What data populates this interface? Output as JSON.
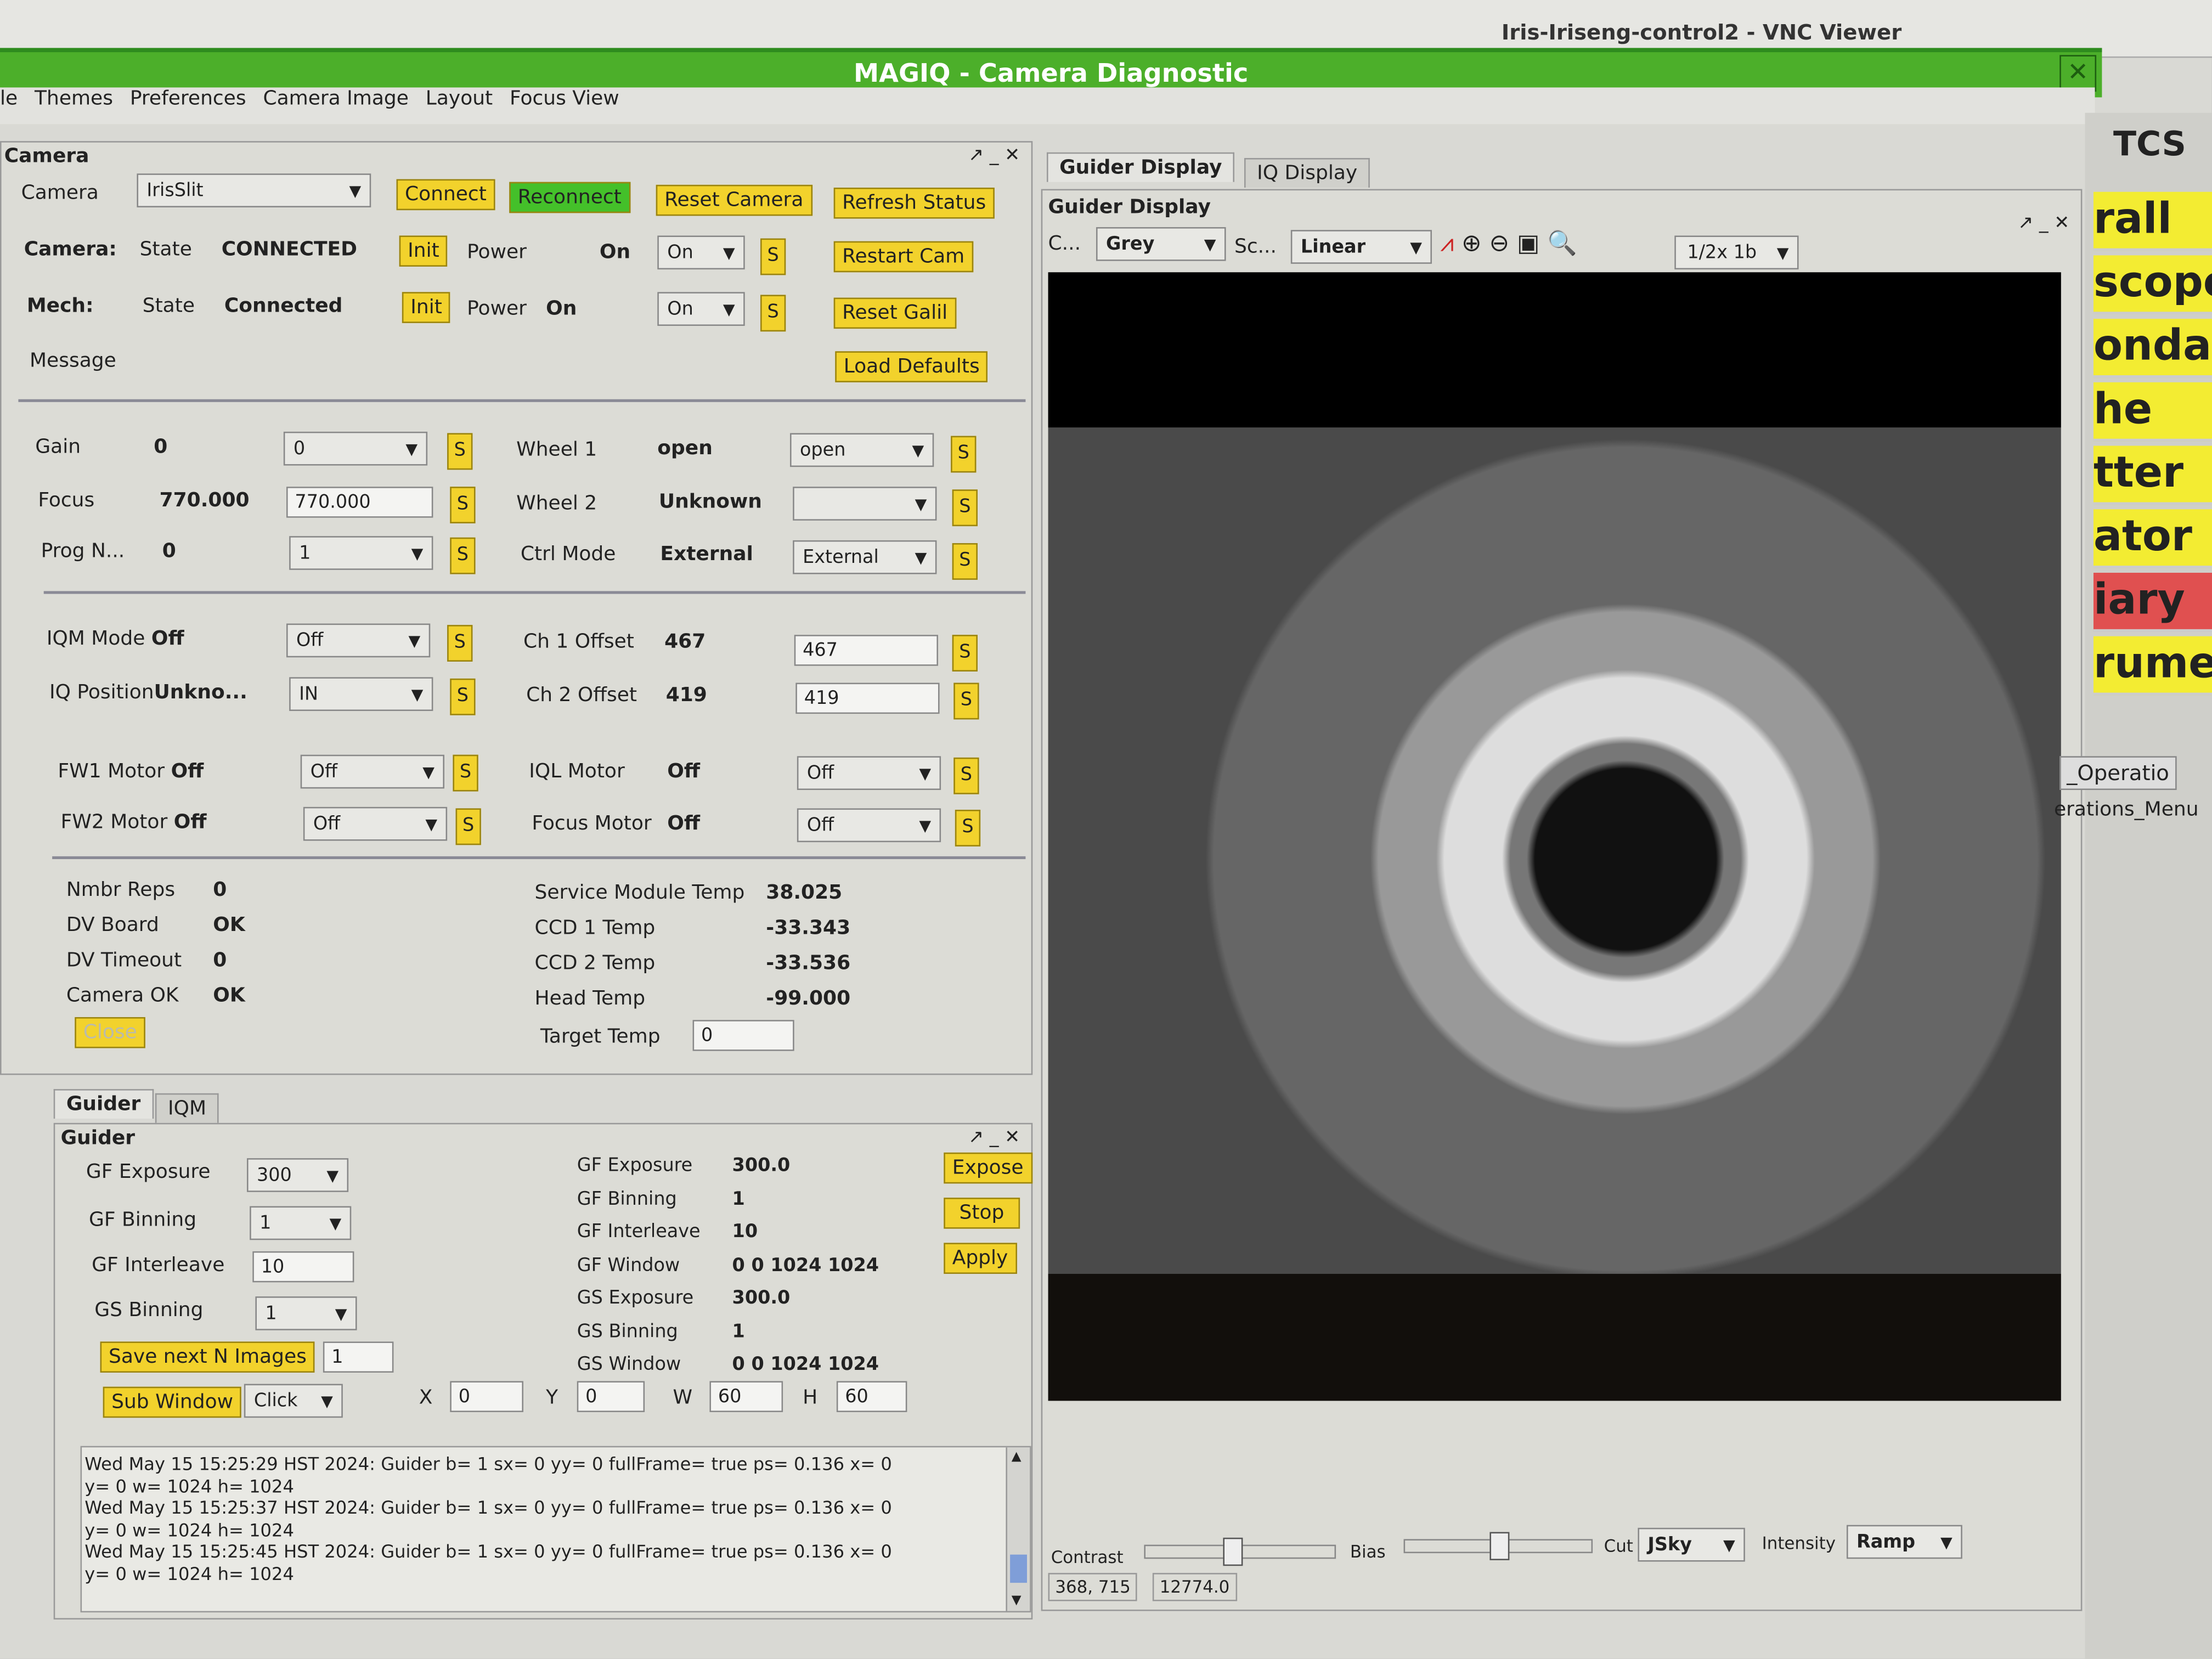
{
  "vnc_title": "Iris-Iriseng-control2 - VNC Viewer",
  "app_title": "MAGIQ - Camera Diagnostic",
  "menu": [
    "le",
    "Themes",
    "Preferences",
    "Camera Image",
    "Layout",
    "Focus View"
  ],
  "camera": {
    "panel_title": "Camera",
    "camera_label": "Camera",
    "camera_value": "IrisSlit",
    "connect": "Connect",
    "reconnect": "Reconnect",
    "reset_camera": "Reset Camera",
    "refresh_status": "Refresh Status",
    "cam_label": "Camera:",
    "state_label": "State",
    "cam_state": "CONNECTED",
    "init": "Init",
    "power_label": "Power",
    "cam_power": "On",
    "cam_power_sel": "On",
    "s": "S",
    "restart_cam": "Restart Cam",
    "mech_label": "Mech:",
    "mech_state": "Connected",
    "mech_power_label": "Power",
    "mech_power": "On",
    "mech_power_sel": "On",
    "reset_galil": "Reset Galil",
    "message_label": "Message",
    "load_defaults": "Load Defaults",
    "gain_label": "Gain",
    "gain": "0",
    "gain_sel": "0",
    "focus_label": "Focus",
    "focus": "770.000",
    "focus_input": "770.000",
    "prog_label": "Prog N...",
    "prog": "0",
    "prog_sel": "1",
    "wheel1_label": "Wheel 1",
    "wheel1": "open",
    "wheel1_sel": "open",
    "wheel2_label": "Wheel 2",
    "wheel2": "Unknown",
    "wheel2_sel": "",
    "ctrl_label": "Ctrl Mode",
    "ctrl": "External",
    "ctrl_sel": "External",
    "iqm_label": "IQM Mode",
    "iqm": "Off",
    "iqm_sel": "Off",
    "iqpos_label": "IQ Position",
    "iqpos": "Unkno...",
    "iqpos_sel": "IN",
    "ch1_label": "Ch 1 Offset",
    "ch1": "467",
    "ch1_input": "467",
    "ch2_label": "Ch 2 Offset",
    "ch2": "419",
    "ch2_input": "419",
    "fw1_label": "FW1 Motor",
    "fw1": "Off",
    "fw1_sel": "Off",
    "fw2_label": "FW2 Motor",
    "fw2": "Off",
    "fw2_sel": "Off",
    "iql_label": "IQL Motor",
    "iql": "Off",
    "iql_sel": "Off",
    "fm_label": "Focus Motor",
    "fm": "Off",
    "fm_sel": "Off",
    "status": [
      [
        "Nmbr Reps",
        "0"
      ],
      [
        "DV Board",
        "OK"
      ],
      [
        "DV Timeout",
        "0"
      ],
      [
        "Camera OK",
        "OK"
      ]
    ],
    "temps": [
      [
        "Service Module Temp",
        "38.025"
      ],
      [
        "CCD 1 Temp",
        "-33.343"
      ],
      [
        "CCD 2 Temp",
        "-33.536"
      ],
      [
        "Head Temp",
        "-99.000"
      ]
    ],
    "target_label": "Target Temp",
    "target": "0",
    "close": "Close"
  },
  "guider": {
    "tabs": [
      "Guider",
      "IQM"
    ],
    "panel_title": "Guider",
    "fields": [
      [
        "GF Exposure",
        "300"
      ],
      [
        "GF Binning",
        "1"
      ],
      [
        "GF Interleave",
        "10"
      ],
      [
        "GS Binning",
        "1"
      ]
    ],
    "save_next": "Save next N Images",
    "save_n": "1",
    "sub_window": "Sub Window",
    "click_sel": "Click",
    "x_label": "X",
    "x": "0",
    "y_label": "Y",
    "y": "0",
    "w_label": "W",
    "w": "60",
    "h_label": "H",
    "h": "60",
    "readouts": [
      [
        "GF Exposure",
        "300.0"
      ],
      [
        "GF Binning",
        "1"
      ],
      [
        "GF Interleave",
        "10"
      ],
      [
        "GF Window",
        "0 0 1024 1024"
      ],
      [
        "GS Exposure",
        "300.0"
      ],
      [
        "GS Binning",
        "1"
      ],
      [
        "GS Window",
        "0 0 1024 1024"
      ]
    ],
    "expose": "Expose",
    "stop": "Stop",
    "apply": "Apply",
    "log": [
      "Wed May 15 15:25:29 HST 2024: Guider b= 1 sx= 0 yy= 0 fullFrame= true ps= 0.136 x= 0",
      "y= 0 w= 1024 h= 1024",
      "Wed May 15 15:25:37 HST 2024: Guider b= 1 sx= 0 yy= 0 fullFrame= true ps= 0.136 x= 0",
      "y= 0 w= 1024 h= 1024",
      "Wed May 15 15:25:45 HST 2024: Guider b= 1 sx= 0 yy= 0 fullFrame= true ps= 0.136 x= 0",
      "y= 0 w= 1024 h= 1024"
    ]
  },
  "display": {
    "tabs": [
      "Guider Display",
      "IQ Display"
    ],
    "panel_title": "Guider Display",
    "c_label": "C...",
    "color_sel": "Grey",
    "sc_label": "Sc...",
    "scale_sel": "Linear",
    "zoom": "1/2x 1b",
    "contrast_label": "Contrast",
    "contrast_level": 0.45,
    "bias_label": "Bias",
    "bias_level": 0.5,
    "cut_label": "Cut",
    "cut_sel": "JSky",
    "intensity_label": "Intensity",
    "intensity_sel": "Ramp",
    "coords": "368, 715",
    "pixel_value": "12774.0"
  },
  "tcs": {
    "title": "TCS",
    "items": [
      "rall",
      "scope",
      "ondar",
      "he",
      "tter",
      "ator",
      "iary",
      "rument"
    ],
    "alert_color": "#e05050",
    "item_color": "#f3ec32",
    "tab": "_Operatio",
    "menu": "erations_Menu"
  }
}
